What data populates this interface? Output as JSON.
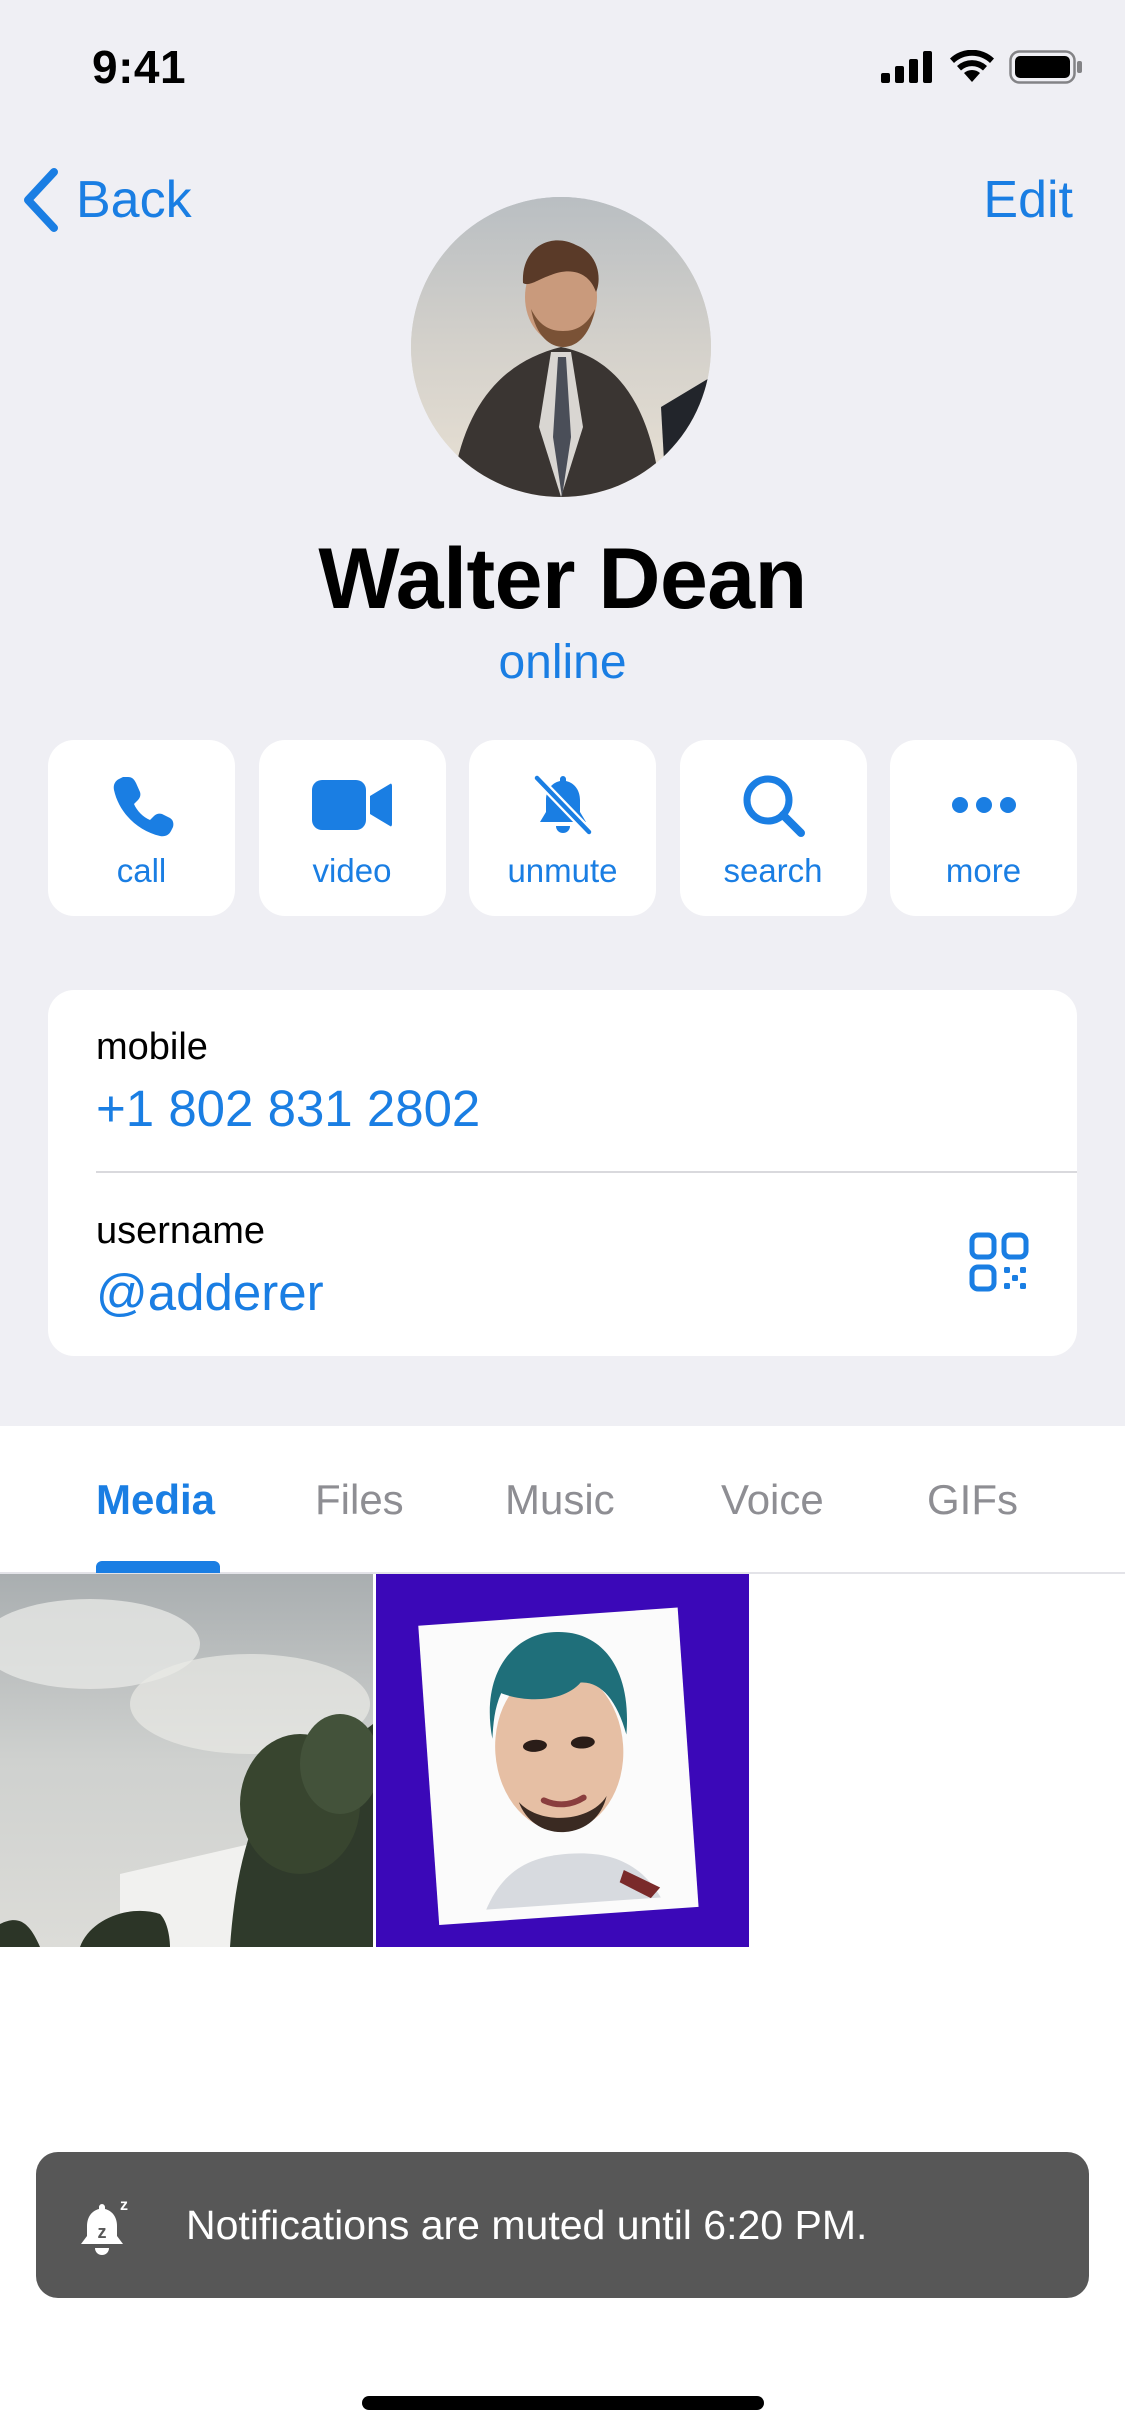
{
  "status_bar": {
    "time": "9:41"
  },
  "nav": {
    "back_label": "Back",
    "edit_label": "Edit"
  },
  "profile": {
    "name": "Walter Dean",
    "status": "online"
  },
  "actions": [
    {
      "label": "call",
      "icon": "phone-icon"
    },
    {
      "label": "video",
      "icon": "video-camera-icon"
    },
    {
      "label": "unmute",
      "icon": "bell-slash-icon"
    },
    {
      "label": "search",
      "icon": "search-icon"
    },
    {
      "label": "more",
      "icon": "ellipsis-icon"
    }
  ],
  "info": {
    "mobile_label": "mobile",
    "mobile_value": "+1 802 831 2802",
    "username_label": "username",
    "username_value": "@adderer",
    "qr_icon": "qr-code-icon"
  },
  "tabs": [
    {
      "label": "Media",
      "active": true
    },
    {
      "label": "Files",
      "active": false
    },
    {
      "label": "Music",
      "active": false
    },
    {
      "label": "Voice",
      "active": false
    },
    {
      "label": "GIFs",
      "active": false
    }
  ],
  "media": [
    {
      "description_icon": "landscape-photo"
    },
    {
      "description_icon": "portrait-illustration"
    }
  ],
  "toast": {
    "text": "Notifications are muted until 6:20 PM.",
    "icon": "bell-snooze-icon"
  },
  "colors": {
    "accent": "#1a7ee3",
    "background": "#efeff4",
    "toast": "#575757",
    "card": "#ffffff"
  }
}
